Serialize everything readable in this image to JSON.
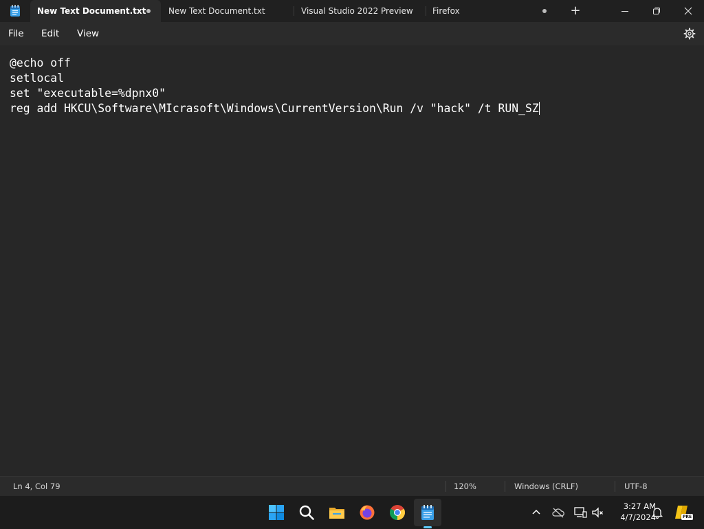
{
  "window": {
    "tabs": [
      {
        "label": "New Text Document.txt",
        "active": true,
        "unsaved": true
      },
      {
        "label": "New Text Document.txt",
        "active": false,
        "unsaved": false
      },
      {
        "label": "Visual Studio 2022 Preview",
        "active": false,
        "unsaved": false
      },
      {
        "label": "Firefox",
        "active": false,
        "unsaved": true
      }
    ],
    "new_tab_glyph": "+",
    "controls": [
      "minimize-icon",
      "maximize-icon",
      "close-icon"
    ]
  },
  "menu": {
    "items": [
      "File",
      "Edit",
      "View"
    ],
    "settings_icon": "gear-icon"
  },
  "editor": {
    "lines": [
      "@echo off",
      "setlocal",
      "set \"executable=%dpnx0\"",
      "reg add HKCU\\Software\\MIcrasoft\\Windows\\CurrentVersion\\Run /v \"hack\" /t RUN_SZ"
    ]
  },
  "status": {
    "position": "Ln 4, Col 79",
    "zoom": "120%",
    "line_ending": "Windows (CRLF)",
    "encoding": "UTF-8"
  },
  "taskbar": {
    "icons": [
      "start-icon",
      "search-icon",
      "file-explorer-icon",
      "firefox-icon",
      "chrome-icon",
      "notepad-icon"
    ],
    "tray": [
      "chevron-up-icon",
      "cloud-offline-icon",
      "network-icon",
      "volume-muted-icon",
      "bell-icon",
      "copilot-pre-icon"
    ],
    "time": "3:27 AM",
    "date": "4/7/2024",
    "copilot_badge": "PRE"
  },
  "colors": {
    "accent": "#60cdff",
    "background": "#272727",
    "titlebar": "#202020"
  }
}
